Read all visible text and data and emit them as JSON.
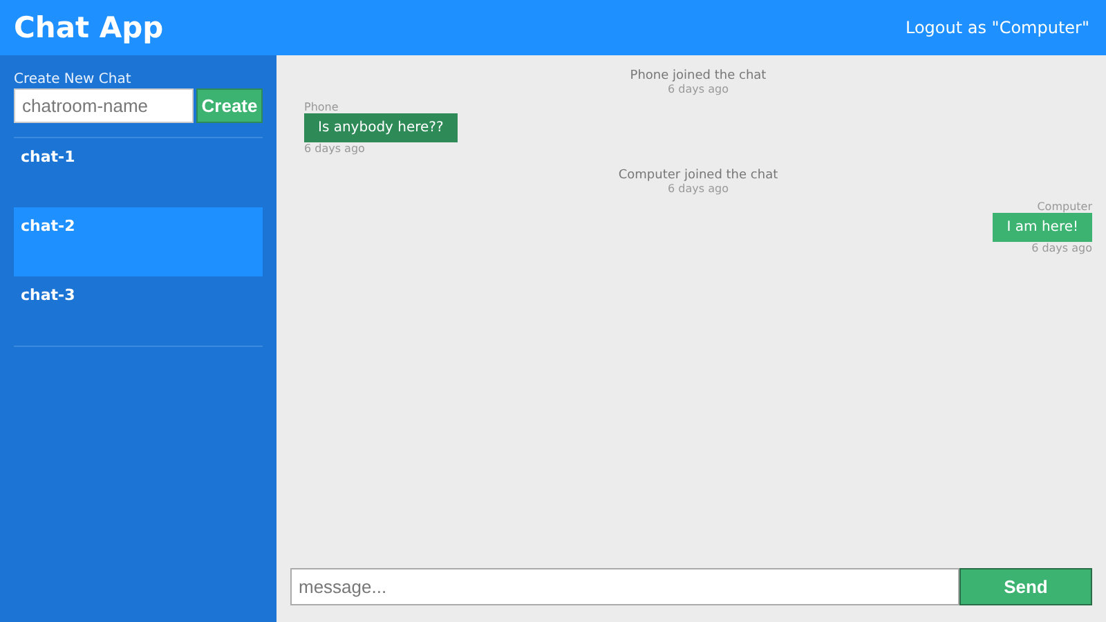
{
  "header": {
    "title": "Chat App",
    "logout": "Logout as \"Computer\""
  },
  "sidebar": {
    "create_label": "Create New Chat",
    "input_placeholder": "chatroom-name",
    "create_button": "Create",
    "chats": [
      {
        "name": "chat-1",
        "selected": false
      },
      {
        "name": "chat-2",
        "selected": true
      },
      {
        "name": "chat-3",
        "selected": false
      }
    ]
  },
  "messages": [
    {
      "kind": "event",
      "text": "Phone joined the chat",
      "time": "6 days ago"
    },
    {
      "kind": "message",
      "own": false,
      "sender": "Phone",
      "text": "Is anybody here??",
      "time": "6 days ago"
    },
    {
      "kind": "event",
      "text": "Computer joined the chat",
      "time": "6 days ago"
    },
    {
      "kind": "message",
      "own": true,
      "sender": "Computer",
      "text": "I am here!",
      "time": "6 days ago"
    }
  ],
  "composer": {
    "placeholder": "message...",
    "send_button": "Send"
  }
}
